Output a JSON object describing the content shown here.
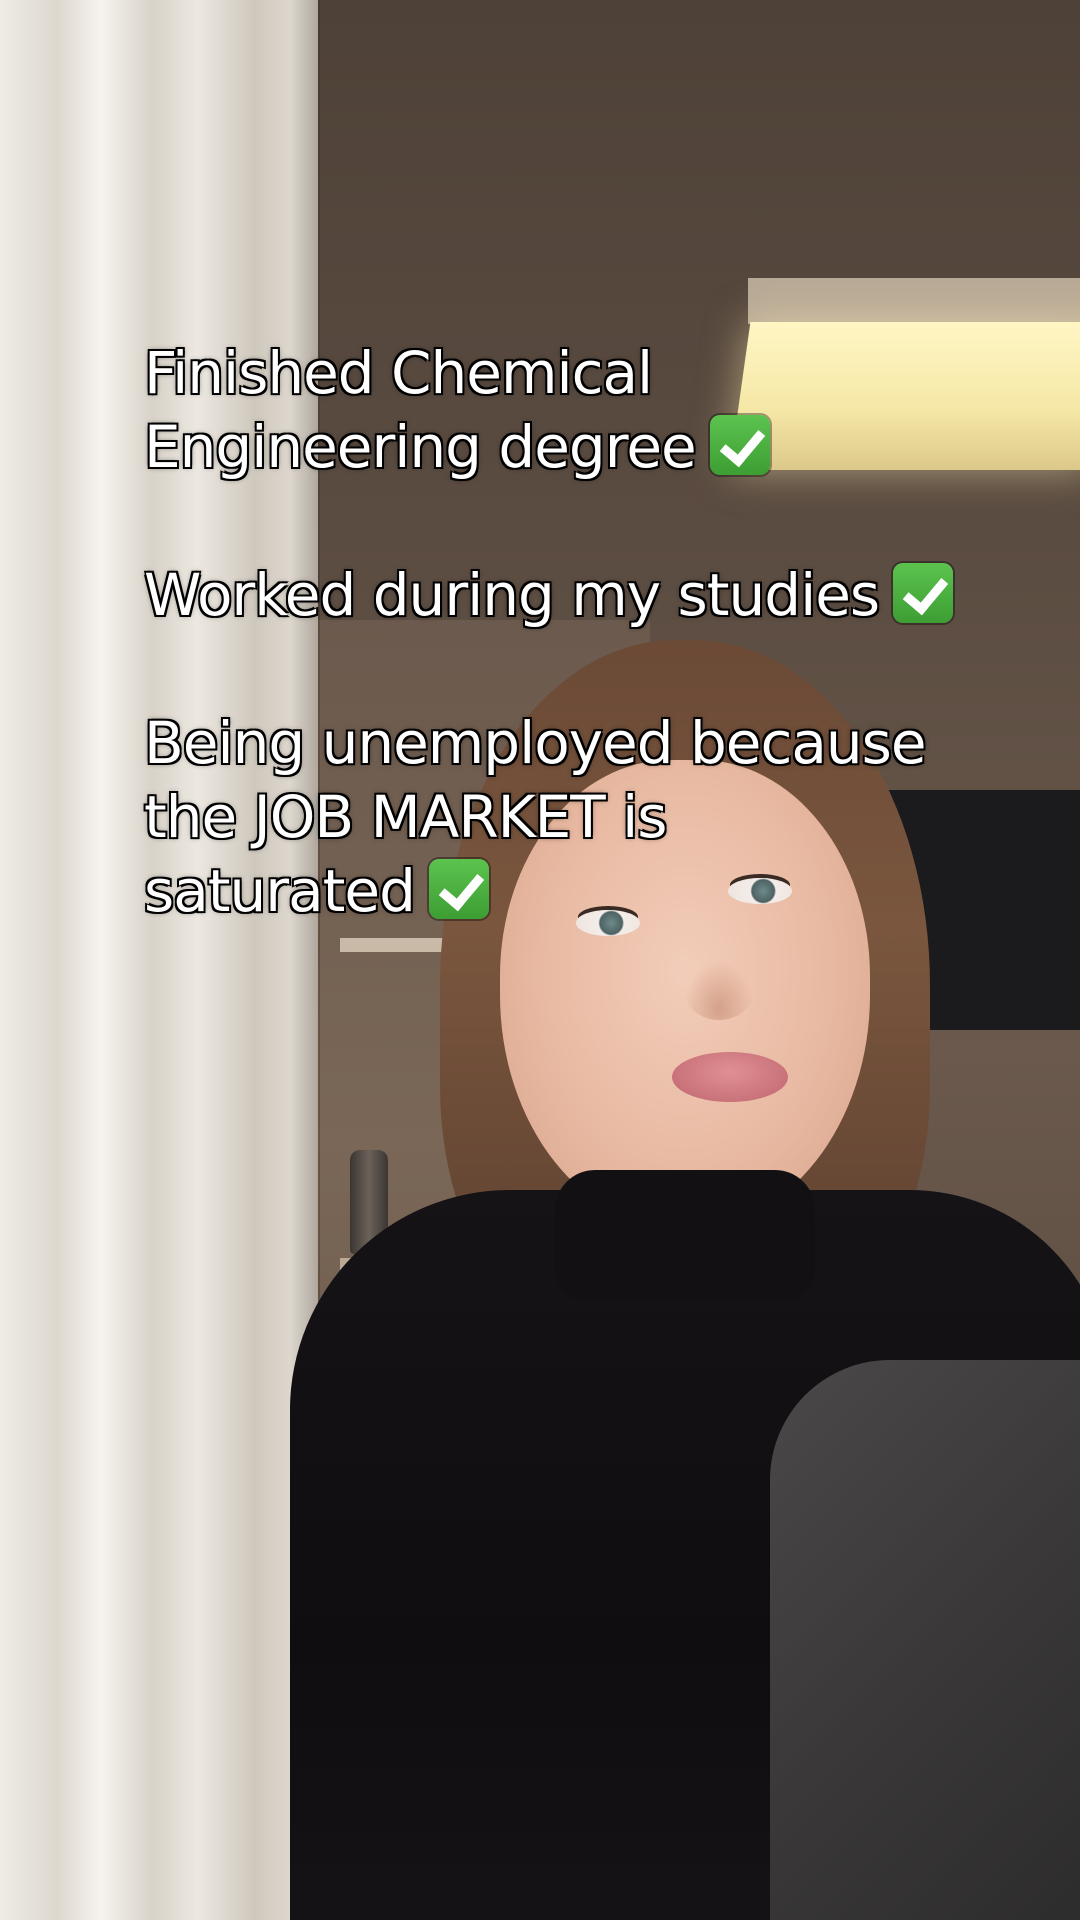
{
  "caption": {
    "line1": "Finished Chemical",
    "line2": "Engineering degree",
    "line3": "Worked during my studies",
    "line4": "Being unemployed because",
    "line5": "the JOB MARKET is",
    "line6": "saturated"
  },
  "icons": {
    "check": "white-check-mark-icon"
  },
  "colors": {
    "caption_text": "#ffffff",
    "check_green": "#3fae3a"
  }
}
